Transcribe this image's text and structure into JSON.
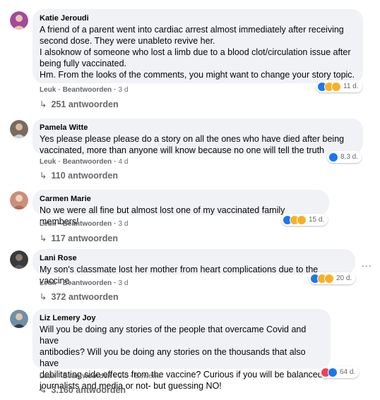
{
  "comments": [
    {
      "author": "Katie Jeroudi",
      "text": "A friend of a parent went into cardiac arrest almost immediately after receiving\nsecond dose. They were unableto revive her.\nI alsoknow of someone who lost a limb due to a blood clot/circulation issue after\nbeing fully vaccinated.\nHm. From the looks of the comments, you might want to change your story topic.",
      "like_label": "Leuk",
      "reply_label": "Beantwoorden",
      "time": "3 d",
      "edited": "",
      "reaction_icons": [
        "like-icon",
        "sad-icon",
        "haha-icon"
      ],
      "reaction_count": "11 d.",
      "replies": "251 antwoorden",
      "avatar_color": "#a04a9a"
    },
    {
      "author": "Pamela Witte",
      "text": "Yes please please please do a story on all the ones who have died after being\nvaccinated, more than anyone will know because no one will tell the truth",
      "like_label": "Leuk",
      "reply_label": "Beantwoorden",
      "time": "4 d",
      "edited": "",
      "reaction_icons": [
        "like-icon"
      ],
      "reaction_count": "8,3 d.",
      "replies": "110 antwoorden",
      "avatar_color": "#7a6a5e"
    },
    {
      "author": "Carmen Marie",
      "text": "No we were all fine but almost lost one of my vaccinated family members!",
      "like_label": "Leuk",
      "reply_label": "Beantwoorden",
      "time": "3 d",
      "edited": "",
      "reaction_icons": [
        "like-icon",
        "sad-icon",
        "haha-icon"
      ],
      "reaction_count": "15 d.",
      "replies": "117 antwoorden",
      "avatar_color": "#c98f7a"
    },
    {
      "author": "Lani Rose",
      "text": "My son's classmate lost her mother from heart complications due to the vaccine.",
      "like_label": "Leuk",
      "reply_label": "Beantwoorden",
      "time": "3 d",
      "edited": "",
      "reaction_icons": [
        "like-icon",
        "sad-icon",
        "haha-icon"
      ],
      "reaction_count": "20 d.",
      "replies": "372 antwoorden",
      "avatar_color": "#3a3a3a"
    },
    {
      "author": "Liz Lemery Joy",
      "text": "Will you be doing any stories of the people that overcame Covid and have\nantibodies? Will you be doing any stories on the thousands that also have\ndebilitating side effects from the vaccine? Curious if you will be balanced\njournalists and media or not- but guessing NO!",
      "like_label": "Leuk",
      "reply_label": "Beantwoorden",
      "time": "2 d",
      "edited": "Bewerkt",
      "reaction_icons": [
        "love-icon",
        "like-icon"
      ],
      "reaction_count": "64 d.",
      "replies": "3.160 antwoorden",
      "avatar_color": "#6f8fa8"
    }
  ],
  "more_options": "..."
}
